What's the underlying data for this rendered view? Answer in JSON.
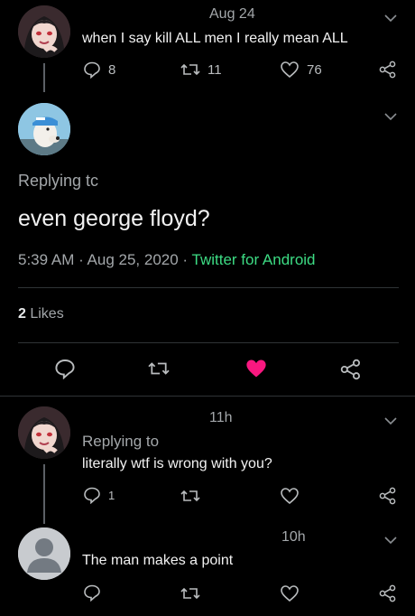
{
  "tweet1": {
    "time": "Aug 24",
    "text": "when I say kill ALL men I really mean ALL",
    "replies": "8",
    "retweets": "11",
    "likes": "76"
  },
  "main_tweet": {
    "replying_to": "Replying tc",
    "text": "even george floyd?",
    "timestamp": "5:39 AM · Aug 25, 2020 · ",
    "source": "Twitter for Android",
    "likes_count": "2",
    "likes_label": " Likes",
    "like_color": "#f91880",
    "link_color": "#1d9bf0"
  },
  "reply1": {
    "time": "11h",
    "replying_to": "Replying to",
    "text": "literally wtf is wrong with you?",
    "replies": "1"
  },
  "reply2": {
    "time": "10h",
    "text": "The man makes a point"
  }
}
